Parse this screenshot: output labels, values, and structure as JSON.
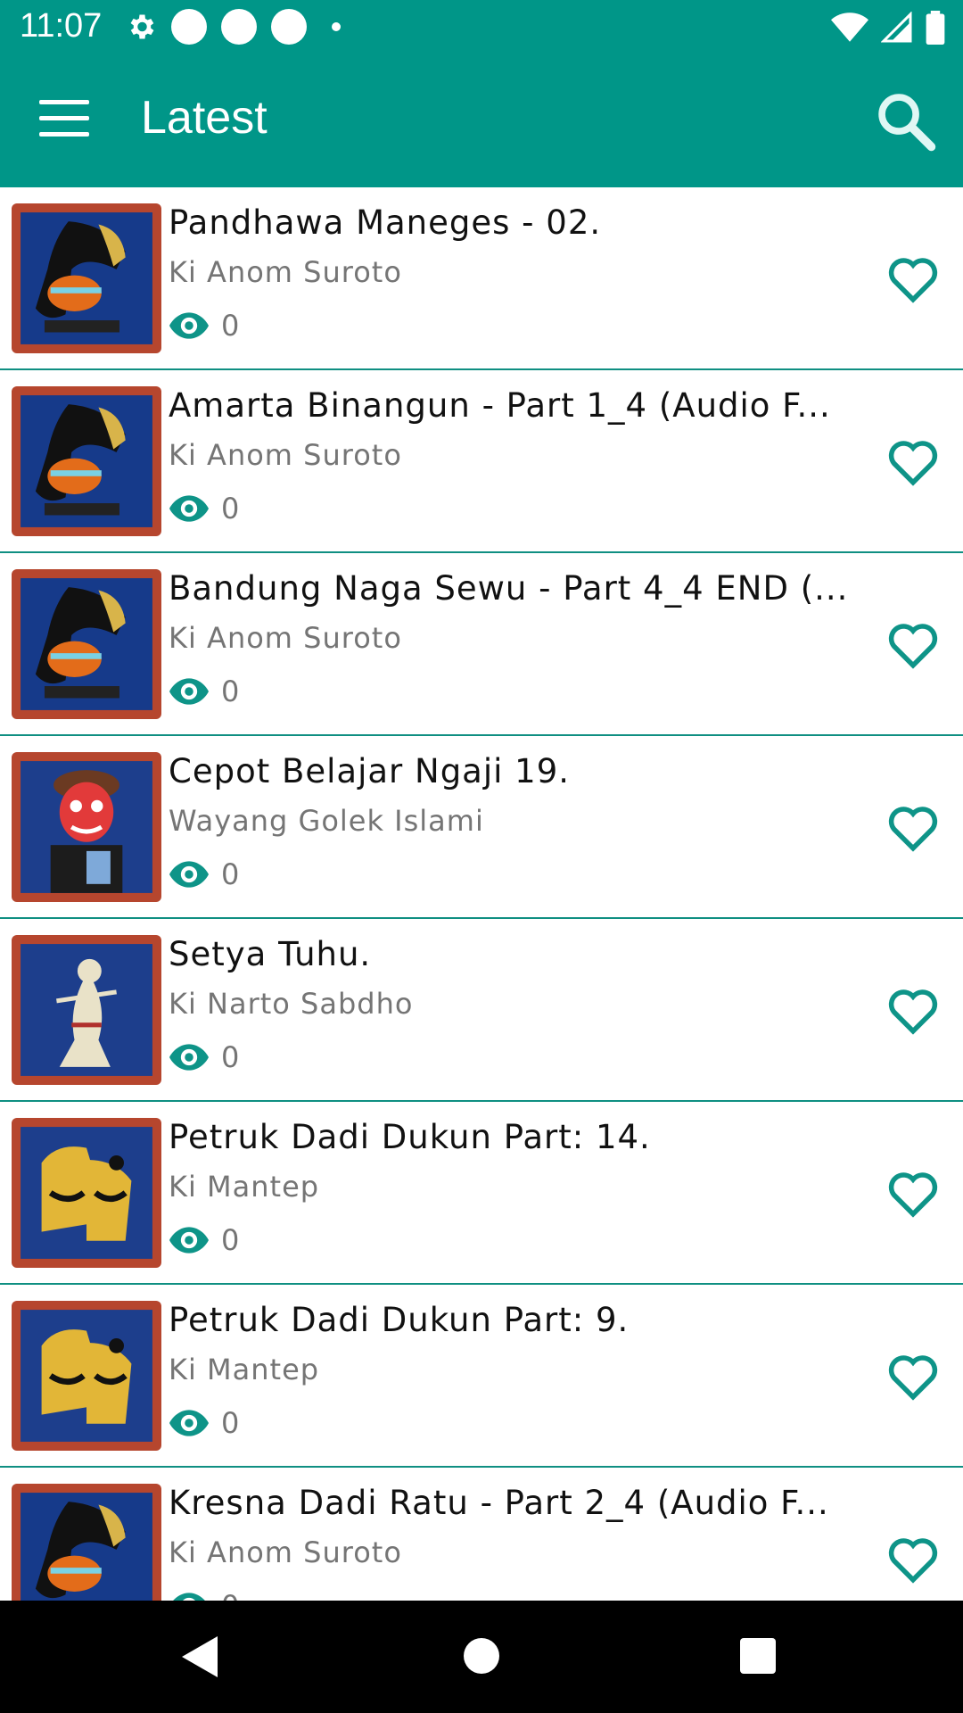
{
  "status": {
    "time": "11:07"
  },
  "appbar": {
    "title": "Latest"
  },
  "colors": {
    "primary": "#009688",
    "accent": "#0e9488",
    "text_secondary": "#757575"
  },
  "items": [
    {
      "title": "Pandhawa Maneges - 02.",
      "artist": "Ki Anom Suroto",
      "views": "0",
      "thumb": "wayang-black-gold"
    },
    {
      "title": "Amarta Binangun - Part 1_4 (Audio F...",
      "artist": "Ki Anom Suroto",
      "views": "0",
      "thumb": "wayang-black-gold"
    },
    {
      "title": "Bandung Naga Sewu - Part 4_4 END (...",
      "artist": "Ki Anom Suroto",
      "views": "0",
      "thumb": "wayang-black-gold"
    },
    {
      "title": "Cepot Belajar Ngaji 19.",
      "artist": "Wayang Golek Islami",
      "views": "0",
      "thumb": "golek-red-face"
    },
    {
      "title": "Setya Tuhu.",
      "artist": "Ki Narto Sabdho",
      "views": "0",
      "thumb": "wayang-white"
    },
    {
      "title": "Petruk Dadi Dukun Part: 14.",
      "artist": "Ki Mantep",
      "views": "0",
      "thumb": "wayang-yellow"
    },
    {
      "title": "Petruk Dadi Dukun Part: 9.",
      "artist": "Ki Mantep",
      "views": "0",
      "thumb": "wayang-yellow"
    },
    {
      "title": "Kresna Dadi Ratu - Part 2_4 (Audio F...",
      "artist": "Ki Anom Suroto",
      "views": "0",
      "thumb": "wayang-black-gold"
    }
  ]
}
